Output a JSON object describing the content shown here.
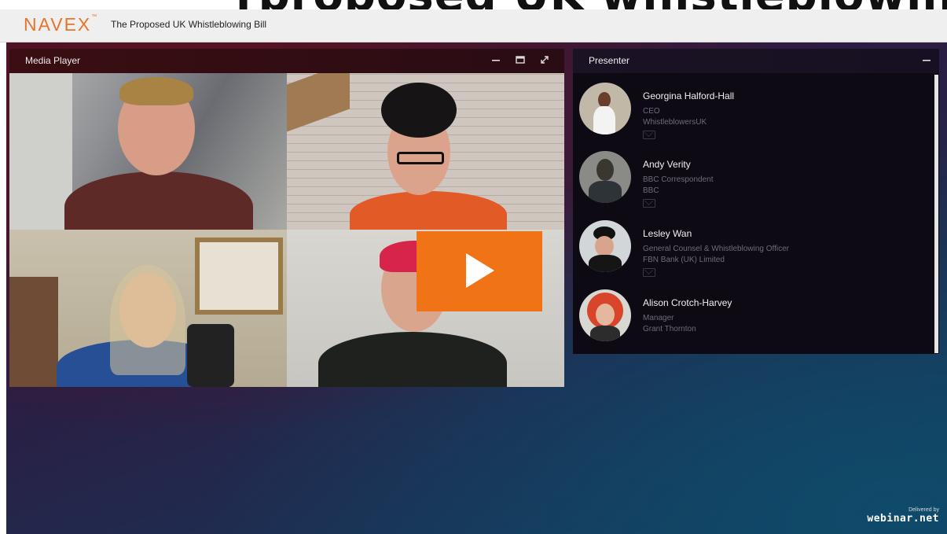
{
  "top_banner": {
    "text": "rproposed UK whistleblowing Bi"
  },
  "header": {
    "logo": "NAVEX",
    "title": "The Proposed UK Whistleblowing Bill"
  },
  "media_player": {
    "title": "Media Player",
    "controls": {
      "minimize_icon": "minimize-icon",
      "maximize_icon": "maximize-icon",
      "fullscreen_icon": "fullscreen-icon"
    },
    "play_button": {
      "icon": "play-icon",
      "color": "#f07316"
    }
  },
  "presenter_panel": {
    "title": "Presenter",
    "collapse_icon": "minimize-icon",
    "presenters": [
      {
        "name": "Georgina Halford-Hall",
        "role": "CEO",
        "org": "WhistleblowersUK"
      },
      {
        "name": "Andy Verity",
        "role": "BBC Correspondent",
        "org": "BBC"
      },
      {
        "name": "Lesley Wan",
        "role": "General Counsel & Whistleblowing Officer",
        "org": "FBN Bank (UK) Limited"
      },
      {
        "name": "Alison Crotch-Harvey",
        "role": "Manager",
        "org": "Grant Thornton"
      }
    ]
  },
  "footer": {
    "delivered_by": "Delivered by",
    "brand": "webinar.net"
  }
}
